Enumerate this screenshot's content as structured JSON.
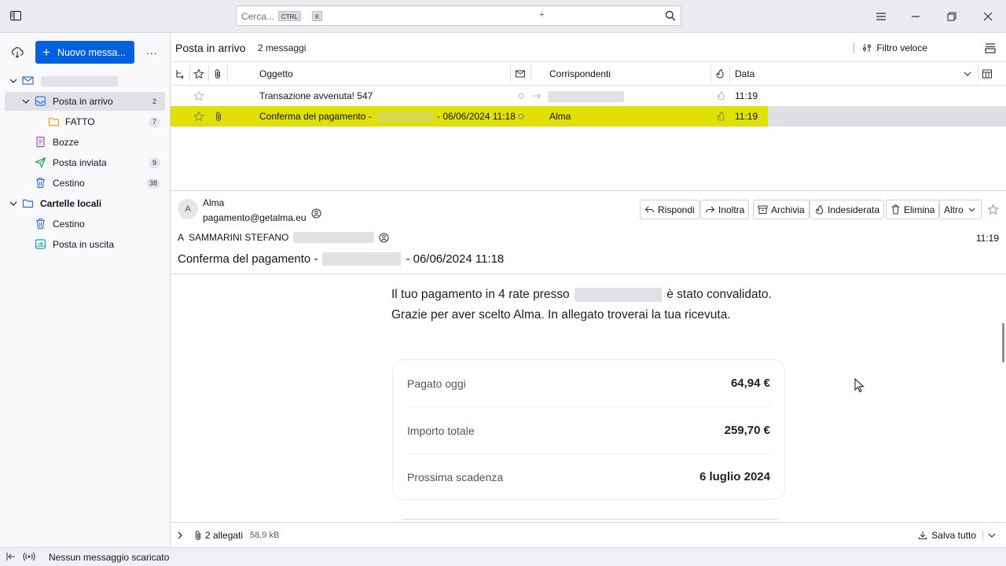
{
  "search": {
    "placeholder": "Cerca...",
    "key_ctrl": "CTRL",
    "key_plus": "+",
    "key_k": "K"
  },
  "folder_pane": {
    "new_message_label": "Nuovo messa...",
    "more": "...",
    "folders": [
      {
        "name": "account-row",
        "label": "",
        "count": ""
      },
      {
        "name": "Posta in arrivo",
        "label": "Posta in arrivo",
        "count": "2"
      },
      {
        "name": "FATTO",
        "label": "FATTO",
        "count": "7"
      },
      {
        "name": "Bozze",
        "label": "Bozze",
        "count": ""
      },
      {
        "name": "Posta inviata",
        "label": "Posta inviata",
        "count": "9"
      },
      {
        "name": "Cestino",
        "label": "Cestino",
        "count": "38"
      },
      {
        "name": "Cartelle locali",
        "label": "Cartelle locali",
        "count": ""
      },
      {
        "name": "Cestino",
        "label": "Cestino",
        "count": ""
      },
      {
        "name": "Posta in uscita",
        "label": "Posta in uscita",
        "count": ""
      }
    ]
  },
  "thread_header": {
    "title": "Posta in arrivo",
    "count": "2 messaggi",
    "quick_filter": "Filtro veloce"
  },
  "columns": {
    "subject": "Oggetto",
    "correspondents": "Corrispondenti",
    "date": "Data"
  },
  "messages": [
    {
      "subject": "Transazione avvenuta! 547",
      "correspondent": "",
      "date": "11:19",
      "starred": false,
      "attachment": false,
      "highlighted": false
    },
    {
      "subject": "Conferma del pagamento -",
      "subject_tail": "- 06/06/2024 11:18",
      "correspondent": "Alma",
      "date": "11:19",
      "starred": true,
      "attachment": true,
      "highlighted": true
    }
  ],
  "message": {
    "avatar_letter": "A",
    "from_name": "Alma",
    "from_email": "pagamento@getalma.eu",
    "actions": {
      "reply": "Rispondi",
      "forward": "Inoltra",
      "archive": "Archivia",
      "junk": "Indesiderata",
      "delete": "Elimina",
      "more": "Altro"
    },
    "to_prefix": "A",
    "to_name": "SAMMARINI STEFANO",
    "time": "11:19",
    "subject_start": "Conferma del pagamento -",
    "subject_end": "- 06/06/2024 11:18",
    "body_part1": "Il tuo pagamento in 4 rate presso",
    "body_part2": "è stato convalidato. Grazie per aver scelto Alma. In allegato troverai la tua ricevuta.",
    "summary": [
      {
        "label": "Pagato oggi",
        "value": "64,94 €"
      },
      {
        "label": "Importo totale",
        "value": "259,70 €"
      },
      {
        "label": "Prossima scadenza",
        "value": "6 luglio 2024"
      }
    ]
  },
  "attachments": {
    "count_label": "2 allegati",
    "size": "58,9 kB",
    "save_all": "Salva tutto"
  },
  "status_bar": {
    "text": "Nessun messaggio scaricato"
  },
  "colors": {
    "accent": "#0061e0",
    "highlight": "#e1e006",
    "selected_row": "#e0e0e4"
  }
}
